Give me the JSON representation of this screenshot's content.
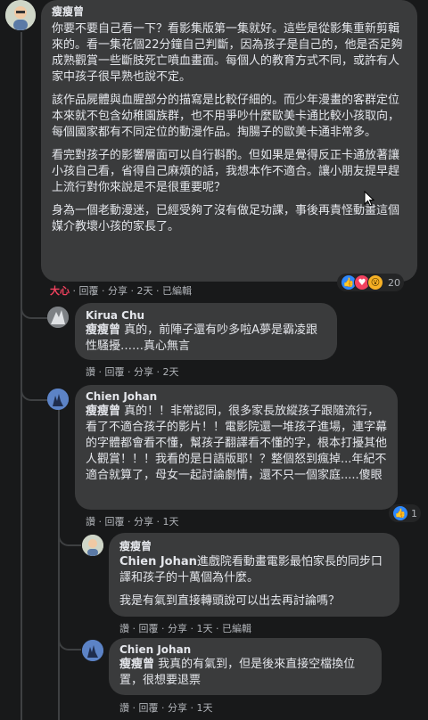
{
  "comments": [
    {
      "author": "瘦瘦曾",
      "paragraphs": [
        "你要不要自己看一下？看影集版第一集就好。這些是從影集重新剪輯來的。看一集花個22分鐘自己判斷，因為孩子是自己的，他是否足夠成熟觀賞一些斷肢死亡噴血畫面。每個人的教育方式不同，或許有人家中孩子很早熟也說不定。",
        "該作品屍體與血腥部分的描寫是比較仔細的。而少年漫畫的客群定位本來就不包含幼稚園族群，也不用爭吵什麼歐美卡通比較小孩取向，每個國家都有不同定位的動漫作品。掏腸子的歐美卡通非常多。",
        "看完對孩子的影響層面可以自行斟酌。但如果是覺得反正卡通放著讓小孩自己看，省得自己麻煩的話，我想本作不適合。讓小朋友提早趕上流行對你來說是不是很重要呢？",
        "身為一個老動漫迷，已經受夠了沒有做足功課，事後再責怪動畫這個媒介教壞小孩的家長了。"
      ],
      "actions": {
        "reaction": "大心",
        "reply": "回覆",
        "share": "分享",
        "time": "2天",
        "edited": "已編輯"
      },
      "reaction_count": "20"
    },
    {
      "author": "Kirua Chu",
      "mention": "瘦瘦曾",
      "text": " 真的，前陣子還有吵多啦A夢是霸凌跟性騷擾……真心無言",
      "actions": {
        "like": "讚",
        "reply": "回覆",
        "share": "分享",
        "time": "2天"
      }
    },
    {
      "author": "Chien Johan",
      "mention": "瘦瘦曾",
      "text": " 真的！！非常認同，很多家長放縱孩子跟隨流行，看了不適合孩子的影片！！電影院還一堆孩子進場，連字幕的字體都會看不懂，幫孩子翻譯看不懂的字，根本打擾其他人觀賞！！！我看的是日語版耶！？整個怒到瘋掉...年紀不適合就算了，母女一起討論劇情，還不只一個家庭.....傻眼",
      "actions": {
        "like": "讚",
        "reply": "回覆",
        "share": "分享",
        "time": "1天"
      },
      "reaction_count": "1"
    },
    {
      "author": "瘦瘦曾",
      "mention": "Chien Johan",
      "text": "進戲院看動畫電影最怕家長的同步口譯和孩子的十萬個為什麼。",
      "text2": "我是有氣到直接轉頭說可以出去再討論嗎？",
      "actions": {
        "like": "讚",
        "reply": "回覆",
        "share": "分享",
        "time": "1天",
        "edited": "已編輯"
      }
    },
    {
      "author": "Chien Johan",
      "mention": "瘦瘦曾",
      "text": " 我真的有氣到，但是後來直接空檔換位置，很想要退票",
      "actions": {
        "like": "讚",
        "reply": "回覆",
        "share": "分享",
        "time": "1天"
      }
    }
  ],
  "separator": "·",
  "icons": {
    "like": "thumbs-up-icon",
    "love": "heart-icon",
    "wow": "wow-icon"
  },
  "colors": {
    "bubble": "#3a3b3c",
    "background": "#18191a",
    "like": "#2d88ff",
    "love": "#f3425f"
  }
}
